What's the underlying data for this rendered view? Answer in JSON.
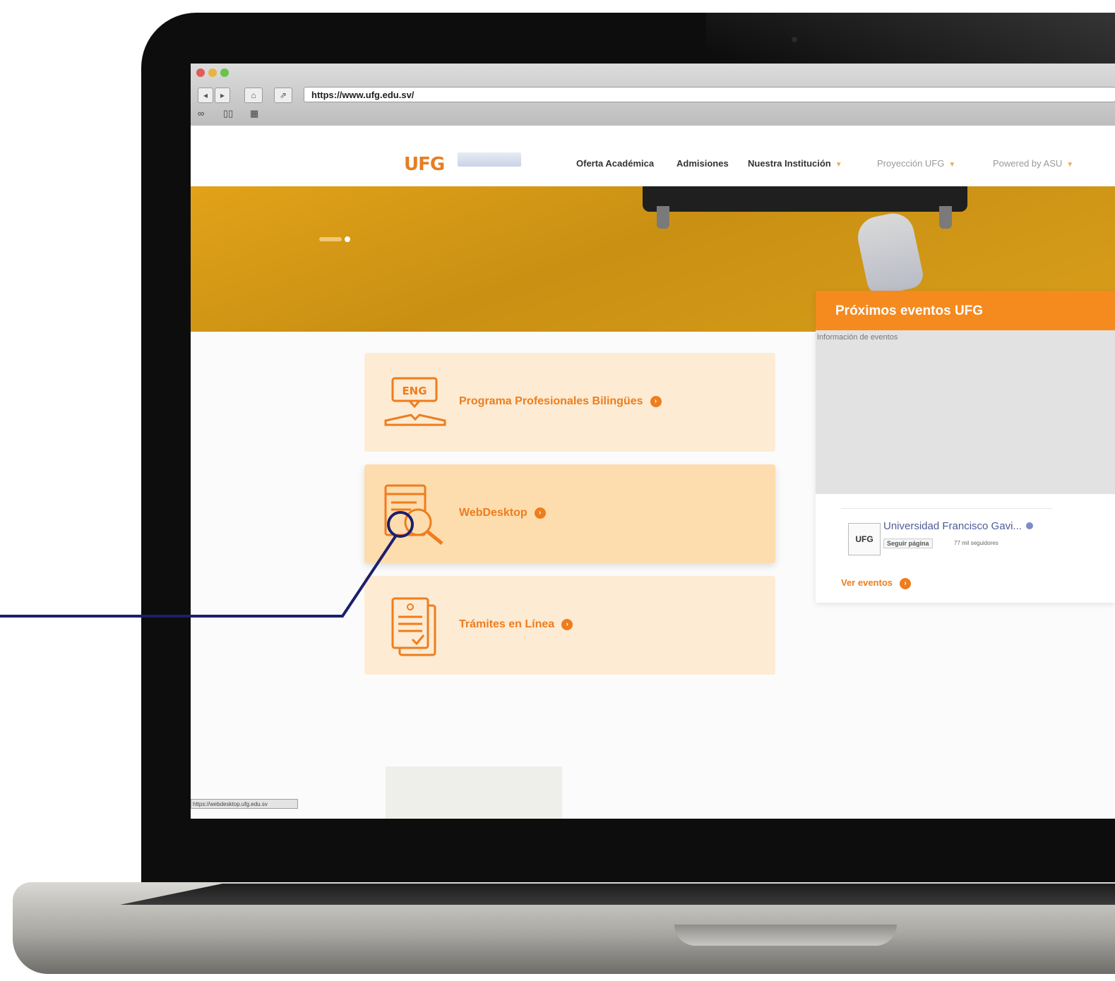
{
  "browser": {
    "url": "https://www.ufg.edu.sv/",
    "status_url": "https://webdesktop.ufg.edu.sv"
  },
  "site": {
    "logo_text": "UFG",
    "menu": [
      {
        "label": "Oferta Académica",
        "has_dropdown": false
      },
      {
        "label": "Admisiones",
        "has_dropdown": false
      },
      {
        "label": "Nuestra Institución",
        "has_dropdown": true
      },
      {
        "label": "Proyección UFG",
        "has_dropdown": true
      },
      {
        "label": "Powered by ASU",
        "has_dropdown": true
      }
    ],
    "cards": [
      {
        "label": "Programa Profesionales Bilingües",
        "icon": "eng-book-icon"
      },
      {
        "label": "WebDesktop",
        "icon": "search-document-icon"
      },
      {
        "label": "Trámites en Línea",
        "icon": "documents-check-icon"
      }
    ],
    "events": {
      "title": "Próximos eventos UFG",
      "image_alt": "Información de eventos",
      "facebook": {
        "page_name": "Universidad Francisco Gavi...",
        "follow_label": "Seguir página",
        "followers": "77 mil seguidores",
        "logo_text": "UFG"
      },
      "link_label": "Ver eventos"
    }
  },
  "colors": {
    "accent": "#ee7d1d",
    "card_bg": "#fdebd4",
    "card_active_bg": "#fddcae",
    "events_header": "#f58a1f",
    "callout_line": "#1b1f6e"
  }
}
